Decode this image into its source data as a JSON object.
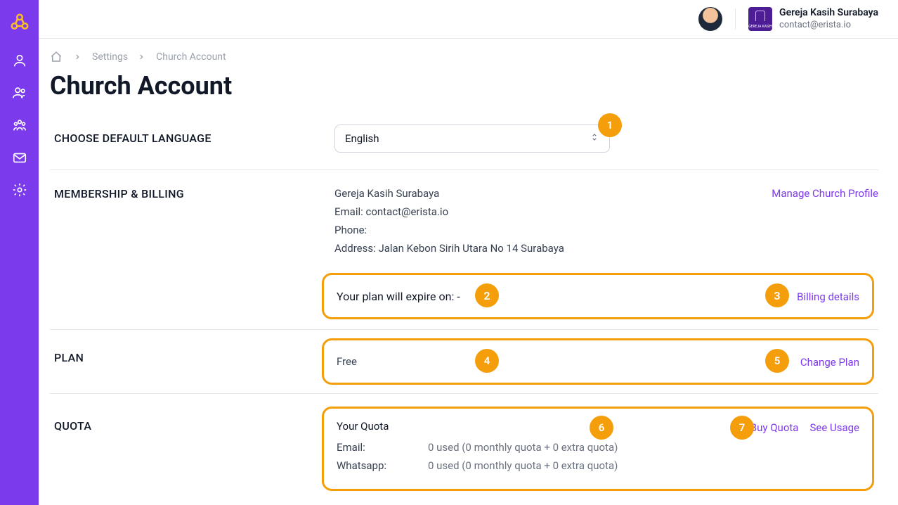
{
  "header": {
    "user_avatar": "user-avatar",
    "org_name": "Gereja Kasih Surabaya",
    "org_email": "contact@erista.io",
    "org_logo_text": "GEREJA KASIH"
  },
  "breadcrumbs": {
    "crumb1": "Settings",
    "crumb2": "Church Account"
  },
  "page_title": "Church Account",
  "language": {
    "section_label": "CHOOSE DEFAULT LANGUAGE",
    "selected": "English"
  },
  "membership": {
    "section_label": "MEMBERSHIP & BILLING",
    "church_name": "Gereja Kasih Surabaya",
    "email_label": "Email: contact@erista.io",
    "phone_label": "Phone:",
    "address_label": "Address: Jalan Kebon Sirih Utara No 14 Surabaya",
    "manage_link": "Manage Church Profile",
    "expire_text": "Your plan will expire on: -",
    "billing_link": "Billing details"
  },
  "plan": {
    "section_label": "PLAN",
    "plan_name": "Free",
    "change_link": "Change Plan"
  },
  "quota": {
    "section_label": "QUOTA",
    "title": "Your Quota",
    "buy_link": "Buy Quota",
    "see_link": "See Usage",
    "rows": {
      "email_key": "Email:",
      "email_val": "0 used (0 monthly quota + 0 extra quota)",
      "wa_key": "Whatsapp:",
      "wa_val": "0 used (0 monthly quota + 0 extra quota)"
    }
  },
  "badges": {
    "b1": "1",
    "b2": "2",
    "b3": "3",
    "b4": "4",
    "b5": "5",
    "b6": "6",
    "b7": "7"
  }
}
